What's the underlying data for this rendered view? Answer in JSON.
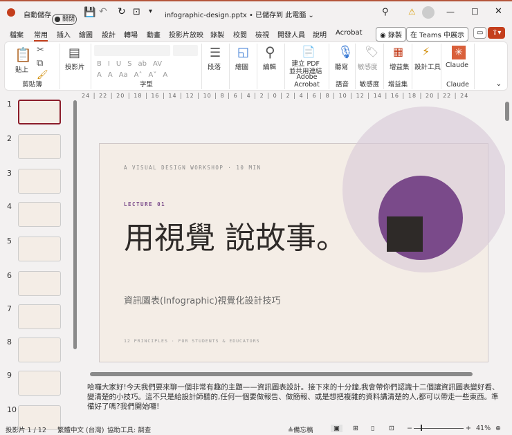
{
  "titlebar": {
    "autosave": "自動儲存",
    "toggle": "關閉",
    "filename": "infographic-design.pptx • 已儲存到 此電腦 ⌄"
  },
  "menu": {
    "tabs": [
      "檔案",
      "常用",
      "插入",
      "繪圖",
      "設計",
      "轉場",
      "動畫",
      "投影片放映",
      "錄製",
      "校閱",
      "檢視",
      "開發人員",
      "說明",
      "Acrobat"
    ],
    "record": "◉ 錄製",
    "teams": "在 Teams 中展示"
  },
  "ribbon": {
    "paste": "貼上",
    "clipboard": "剪貼簿",
    "slides": "投影片",
    "font": "字型",
    "paragraph": "段落",
    "drawing": "繪圖",
    "editing": "編輯",
    "pdf": "建立 PDF\n並共用連結",
    "adobe": "Adobe Acrobat",
    "dictate": "聽寫",
    "voice": "語音",
    "sensitivity": "敏感度",
    "sensitivity_group": "敏感度",
    "addins": "增益集",
    "addins_group": "增益集",
    "designer": "設計工具",
    "claude": "Claude",
    "claude_group": "Claude",
    "format_buttons": [
      "B",
      "I",
      "U",
      "S",
      "ab",
      "AV",
      "A",
      "A",
      "Aa",
      "A˄",
      "A˅",
      "A"
    ]
  },
  "ruler": {
    "text": "24 │ 22 │ 20 │ 18 │ 16 │ 14 │ 12 │ 10 │ 8 │ 6 │ 4 │ 2 │ 0 │ 2 │ 4 │ 6 │ 8 │ 10 │ 12 │ 14 │ 16 │ 18 │ 20 │ 22 │ 24"
  },
  "thumbnails": [
    "1",
    "2",
    "3",
    "4",
    "5",
    "6",
    "7",
    "8",
    "9",
    "10"
  ],
  "slide": {
    "kicker": "A VISUAL DESIGN WORKSHOP · 10 MIN",
    "lecture": "LECTURE 01",
    "title": "用視覺 說故事。",
    "subtitle": "資訊圖表(Infographic)視覺化設計技巧",
    "footer": "12 PRINCIPLES · FOR STUDENTS & EDUCATORS",
    "colors": {
      "purple": "#7a4a8a",
      "dark": "#2e2a28",
      "bg": "#f4ede6",
      "halo": "#e3d8e0"
    }
  },
  "notes": "哈囉大家好!今天我們要來聊一個非常有趣的主題——資訊圖表設計。接下來的十分鐘,我會帶你們認識十二個讓資訊圖表變好看、變清楚的小技巧。這不只是給設計師聽的,任何一個要做報告、做簡報、或是想把複雜的資料講清楚的人,都可以帶走一些東西。準備好了嗎?我們開始囉!",
  "status": {
    "slide": "投影片 1 / 12",
    "language": "繁體中文 (台灣)",
    "accessibility": "協助工具: 調查",
    "notes": "≜備忘稿",
    "zoom": "41%"
  }
}
